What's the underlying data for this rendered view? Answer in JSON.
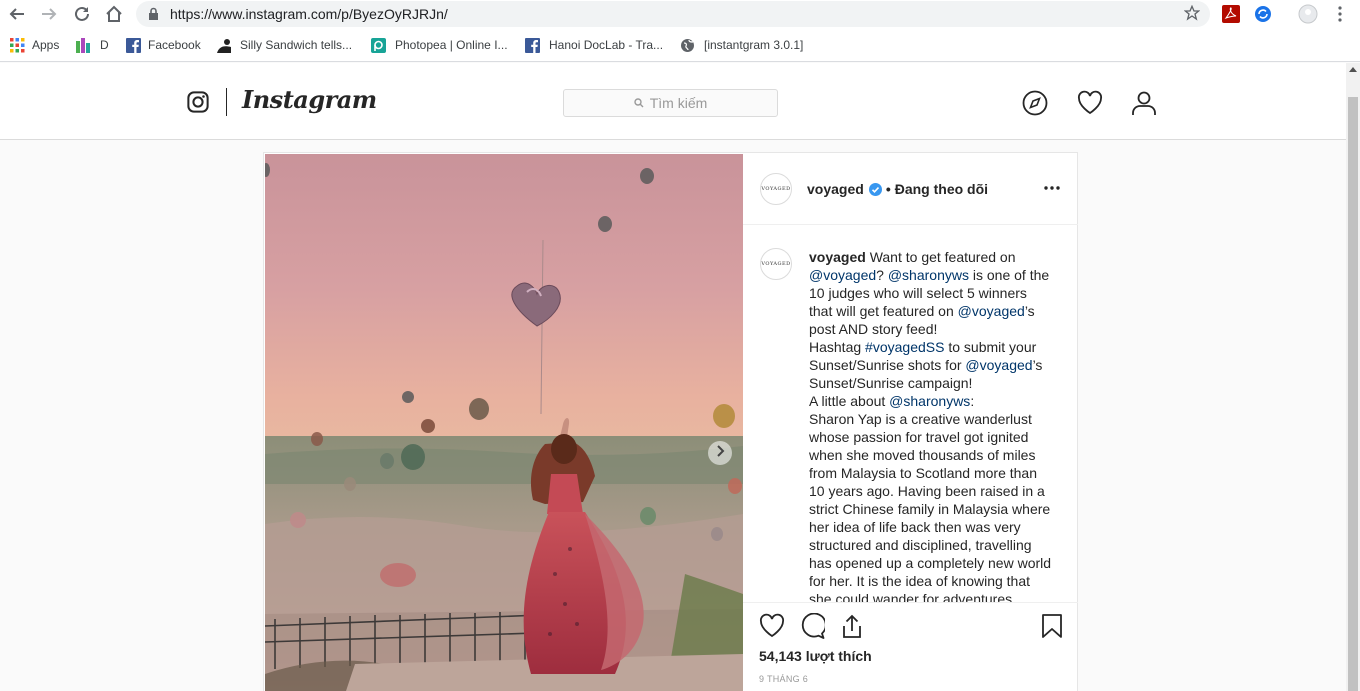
{
  "browser": {
    "url": "https://www.instagram.com/p/ByezOyRJRJn/",
    "bookmarks": [
      "Apps",
      "D",
      "Facebook",
      "Silly Sandwich tells...",
      "Photopea | Online I...",
      "Hanoi DocLab - Tra...",
      "[instantgram 3.0.1]"
    ]
  },
  "instagram": {
    "wordmark": "Instagram",
    "search_placeholder": "Tìm kiếm"
  },
  "post": {
    "avatar_text": "VOYAGED",
    "username": "voyaged",
    "separator": "•",
    "follow_status": "Đang theo dõi",
    "caption": [
      {
        "t": "voyaged",
        "k": "u"
      },
      {
        "t": " ",
        "k": "s"
      },
      {
        "t": "Want to get featured on ",
        "k": "n"
      },
      {
        "t": "@voyaged",
        "k": "l"
      },
      {
        "t": "? ",
        "k": "n"
      },
      {
        "t": "@sharonyws",
        "k": "l"
      },
      {
        "t": " is one of the 10 judges who will select 5 winners that will get featured on ",
        "k": "n"
      },
      {
        "t": "@voyaged",
        "k": "l"
      },
      {
        "t": "’s post AND story feed!",
        "k": "n"
      },
      {
        "t": "",
        "k": "br"
      },
      {
        "t": "Hashtag ",
        "k": "n"
      },
      {
        "t": "#voyagedSS",
        "k": "l"
      },
      {
        "t": " to submit your Sunset/Sunrise shots for ",
        "k": "n"
      },
      {
        "t": "@voyaged",
        "k": "l"
      },
      {
        "t": "’s Sunset/Sunrise campaign!",
        "k": "n"
      },
      {
        "t": "",
        "k": "br"
      },
      {
        "t": "A little about ",
        "k": "n"
      },
      {
        "t": "@sharonyws",
        "k": "l"
      },
      {
        "t": ":",
        "k": "n"
      },
      {
        "t": "",
        "k": "br"
      },
      {
        "t": "Sharon Yap is a creative wanderlust whose passion for travel got ignited when she moved thousands of miles from Malaysia to Scotland more than 10 years ago. Having been raised in a strict Chinese family in Malaysia where her idea of life back then was very structured and disciplined, travelling has opened up a completely new world for her. It is the idea of knowing that she could wander for adventures",
        "k": "n"
      }
    ],
    "likes": "54,143 lượt thích",
    "date": "9 THÁNG 6"
  },
  "colors": {
    "link": "#003569",
    "verified": "#3897f0",
    "border": "#dbdbdb"
  }
}
